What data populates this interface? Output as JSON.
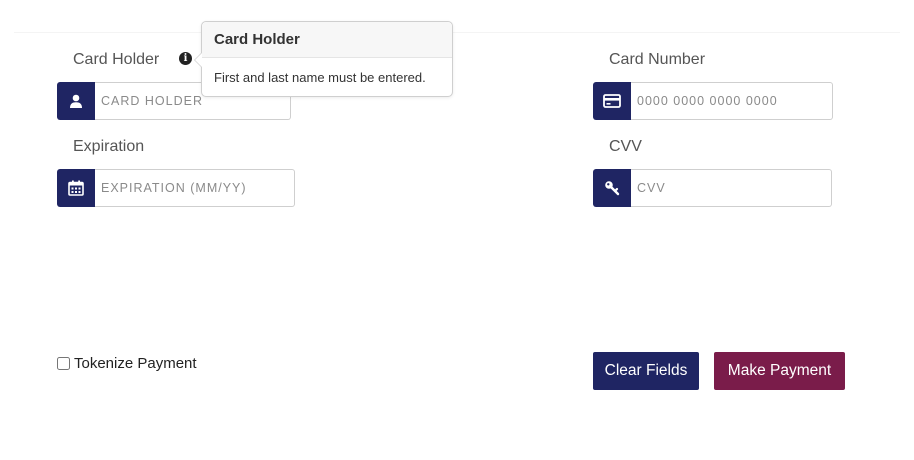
{
  "form": {
    "card_holder": {
      "label": "Card Holder",
      "placeholder": "CARD HOLDER",
      "value": "",
      "icon": "user-icon",
      "info_icon": "info-icon"
    },
    "card_number": {
      "label": "Card Number",
      "placeholder": "0000 0000 0000 0000",
      "value": "",
      "icon": "credit-card-icon"
    },
    "expiration": {
      "label": "Expiration",
      "placeholder": "EXPIRATION (MM/YY)",
      "value": "",
      "icon": "calendar-icon"
    },
    "cvv": {
      "label": "CVV",
      "placeholder": "CVV",
      "value": "",
      "icon": "key-icon"
    }
  },
  "tooltip": {
    "title": "Card Holder",
    "body": "First and last name must be entered."
  },
  "options": {
    "tokenize_label": "Tokenize Payment",
    "tokenize_checked": false
  },
  "buttons": {
    "clear_label": "Clear Fields",
    "pay_label": "Make Payment"
  },
  "colors": {
    "navy": "#1f2563",
    "maroon": "#7a1c4a"
  }
}
